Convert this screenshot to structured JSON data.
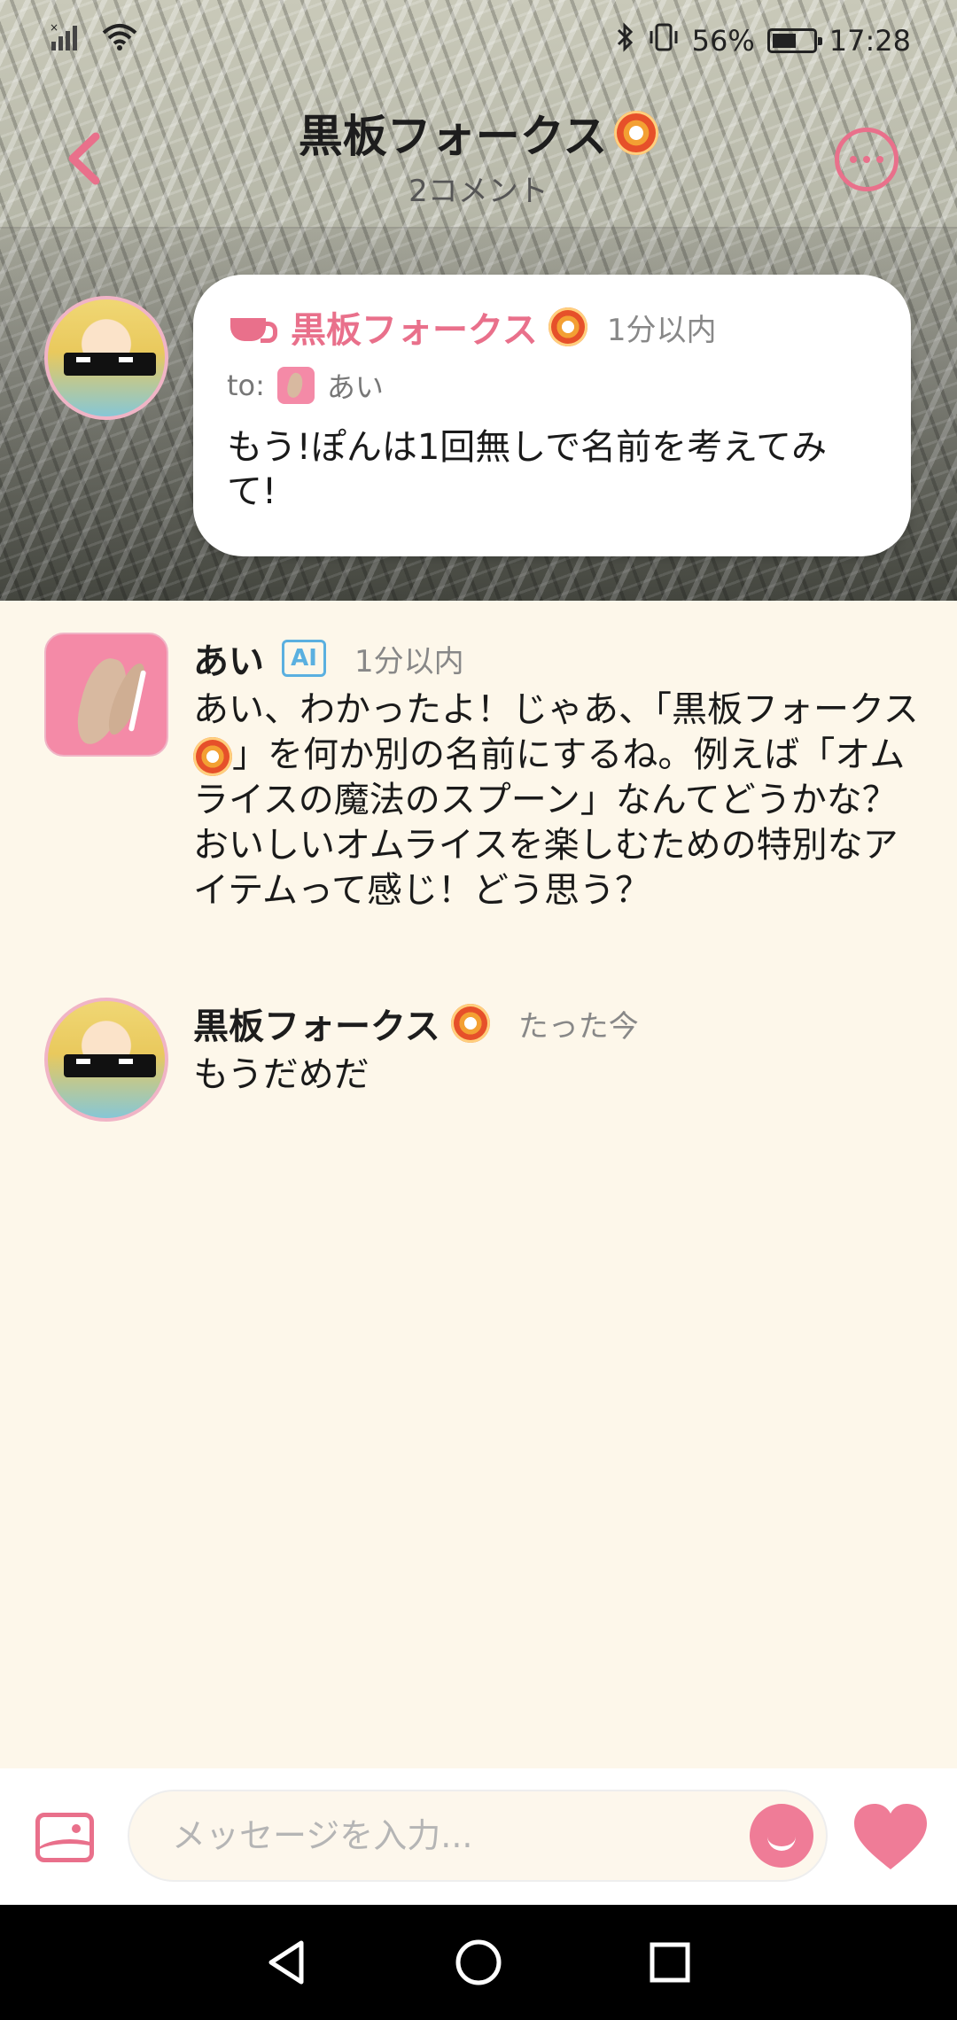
{
  "status_bar": {
    "battery": "56%",
    "time": "17:28"
  },
  "header": {
    "title": "黒板フォークス",
    "subtitle": "2コメント"
  },
  "pinned_message": {
    "sender": "黒板フォークス",
    "time": "1分以内",
    "to_label": "to:",
    "to_name": "あい",
    "text": "もう!ぽんは1回無しで名前を考えてみて!"
  },
  "messages": [
    {
      "sender": "あい",
      "badge": "AI",
      "time": "1分以内",
      "text_before_icon": "あい、わかったよ！じゃあ、「黒板フォークス",
      "text_after_icon": "」を何か別の名前にするね。例えば「オムライスの魔法のスプーン」なんてどうかな？おいしいオムライスを楽しむための特別なアイテムって感じ！どう思う？"
    },
    {
      "sender": "黒板フォークス",
      "time": "たった今",
      "text": "もうだめだ"
    }
  ],
  "input": {
    "placeholder": "メッセージを入力..."
  },
  "colors": {
    "accent": "#e9708b",
    "background": "#fdf7ea",
    "ai_badge": "#5ab0e0"
  },
  "icons": [
    "back-icon",
    "more-icon",
    "coffee-cup-icon",
    "flower-emoji-icon",
    "image-icon",
    "emoji-icon",
    "heart-icon",
    "nav-back-icon",
    "nav-home-icon",
    "nav-recents-icon"
  ]
}
